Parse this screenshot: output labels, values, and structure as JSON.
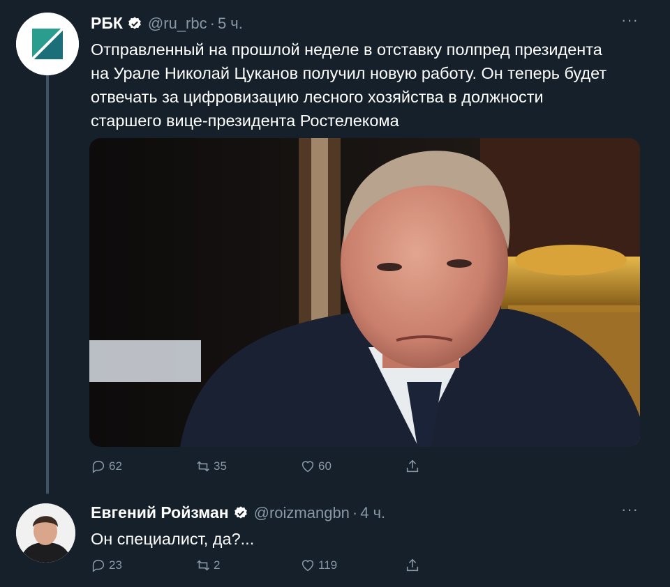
{
  "tweets": [
    {
      "display_name": "РБК",
      "handle": "@ru_rbc",
      "separator": "·",
      "time": "5 ч.",
      "more": "···",
      "text_lines": [
        "Отправленный на прошлой неделе в отставку полпред президента",
        "на Урале Николай Цуканов получил новую работу. Он теперь будет",
        "отвечать за цифровизацию лесного хозяйства в должности",
        "старшего вице-президента Ростелекома"
      ],
      "stats": {
        "replies": "62",
        "retweets": "35",
        "likes": "60"
      }
    },
    {
      "display_name": "Евгений Ройзман",
      "handle": "@roizmangbn",
      "separator": "·",
      "time": "4 ч.",
      "more": "···",
      "text_lines": [
        "Он специалист, да?..."
      ],
      "stats": {
        "replies": "23",
        "retweets": "2",
        "likes": "119"
      }
    }
  ],
  "colors": {
    "background": "#15202b",
    "text_primary": "#ffffff",
    "text_secondary": "#8899a6",
    "verified_blue": "#ffffff",
    "rbc_green": "#1c8f80"
  },
  "icons": {
    "reply": "reply-icon",
    "retweet": "retweet-icon",
    "like": "heart-icon",
    "share": "share-icon",
    "verified": "verified-badge-icon"
  }
}
